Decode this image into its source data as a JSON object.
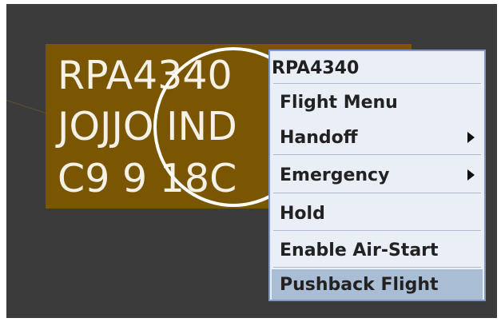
{
  "data_block": {
    "callsign": "RPA4340",
    "route_line": "JOJJO IND",
    "type_line": "C9 9 18C"
  },
  "context_menu": {
    "title": "RPA4340",
    "items": [
      {
        "label": "Flight Menu",
        "submenu": false
      },
      {
        "label": "Handoff",
        "submenu": true
      },
      {
        "label": "Emergency",
        "submenu": true
      },
      {
        "label": "Hold",
        "submenu": false
      },
      {
        "label": "Enable Air-Start",
        "submenu": false
      },
      {
        "label": "Pushback Flight",
        "submenu": false,
        "highlighted": true
      }
    ]
  },
  "colors": {
    "scope_background": "#3b3b3b",
    "data_block_background": "#7a5603",
    "data_block_text": "#f5f1e6",
    "menu_background": "#e9eef7",
    "menu_border": "#8098c2",
    "menu_highlight": "#a9bed4"
  }
}
